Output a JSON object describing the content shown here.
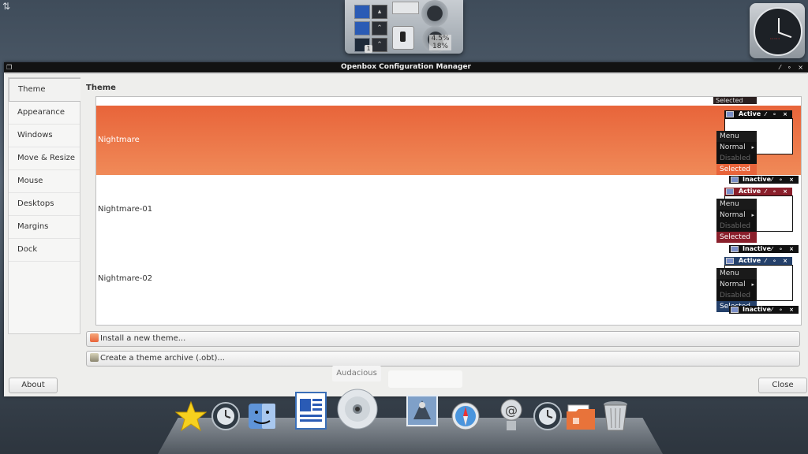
{
  "window": {
    "title": "Openbox Configuration Manager",
    "controls": "⁄ ∘ ×"
  },
  "sidebar": {
    "items": [
      {
        "label": "Theme"
      },
      {
        "label": "Appearance"
      },
      {
        "label": "Windows"
      },
      {
        "label": "Move & Resize"
      },
      {
        "label": "Mouse"
      },
      {
        "label": "Desktops"
      },
      {
        "label": "Margins"
      },
      {
        "label": "Dock"
      }
    ],
    "selected": "Theme"
  },
  "main": {
    "section_title": "Theme",
    "themes": [
      {
        "name": "Nightmare",
        "selected": true,
        "accent": "#f08a58"
      },
      {
        "name": "Nightmare-01",
        "selected": false,
        "accent": "#8a1f2b"
      },
      {
        "name": "Nightmare-02",
        "selected": false,
        "accent": "#24406a"
      }
    ],
    "preview": {
      "selected_tab": "Selected",
      "active": "Active",
      "inactive": "Inactive",
      "menu": "Menu",
      "normal": "Normal",
      "disabled": "Disabled",
      "selected": "Selected"
    },
    "install_button": "Install a new theme...",
    "archive_button": "Create a theme archive (.obt)..."
  },
  "footer": {
    "about": "About",
    "close": "Close"
  },
  "top_panel": {
    "cpu_1": "4.5%",
    "cpu_2": "18%",
    "workspace_number": "1"
  },
  "dock": {
    "tooltip": "Audacious",
    "items": [
      "star-icon",
      "time-machine-icon",
      "finder-icon",
      "document-icon",
      "cd-icon",
      "mail-icon",
      "safari-icon",
      "at-icon",
      "time-machine-icon",
      "folder-icon",
      "trash-icon"
    ]
  },
  "colors": {
    "selection": "#e8643a",
    "titlebar": "#121212"
  }
}
